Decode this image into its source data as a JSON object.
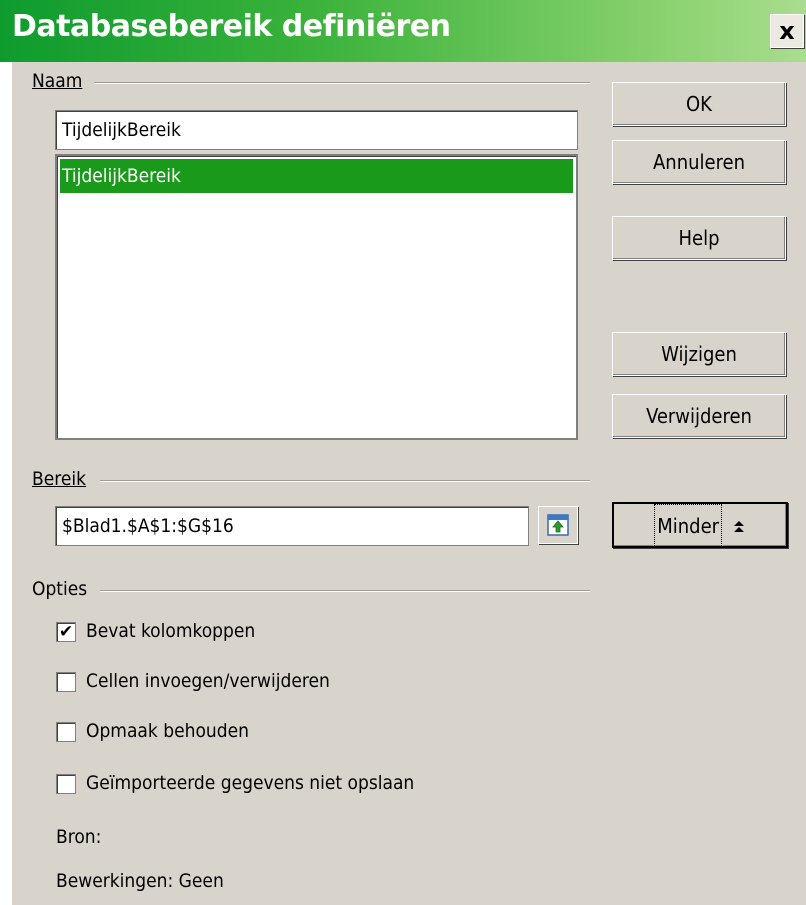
{
  "window": {
    "title": "Databasebereik definiëren",
    "close_symbol": "x"
  },
  "naam": {
    "label": "Naam",
    "input_value": "TijdelijkBereik",
    "list_items": [
      "TijdelijkBereik"
    ]
  },
  "bereik": {
    "label": "Bereik",
    "input_value": "$Blad1.$A$1:$G$16"
  },
  "opties": {
    "label": "Opties",
    "checkboxes": [
      {
        "label": "Bevat kolomkoppen",
        "checked": true
      },
      {
        "label": "Cellen invoegen/verwijderen",
        "checked": false
      },
      {
        "label": "Opmaak behouden",
        "checked": false
      },
      {
        "label": "Geïmporteerde gegevens niet opslaan",
        "checked": false
      }
    ],
    "bron": "Bron:",
    "bewerkingen": "Bewerkingen: Geen"
  },
  "buttons": {
    "ok": "OK",
    "annuleren": "Annuleren",
    "help": "Help",
    "wijzigen": "Wijzigen",
    "verwijderen": "Verwijderen",
    "minder": "Minder",
    "minder_arrow": "≜"
  },
  "colors": {
    "titlebar_start": "#0e9b2e",
    "selection": "#1a9a1a",
    "dialog_bg": "#d8d4cc"
  }
}
